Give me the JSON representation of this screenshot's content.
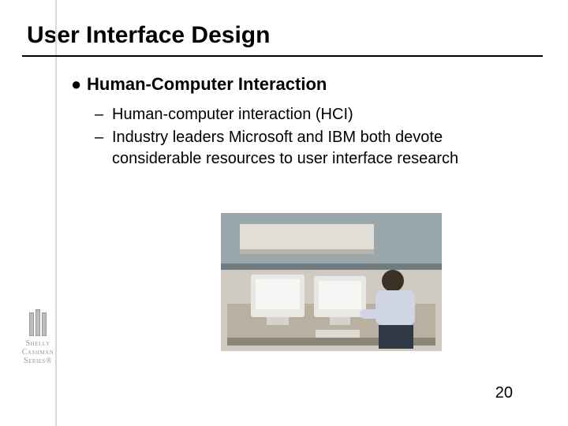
{
  "title": "User Interface Design",
  "bullet": {
    "mark": "●",
    "label": "Human-Computer Interaction",
    "subs": [
      "Human-computer interaction (HCI)",
      "Industry leaders Microsoft and IBM both devote considerable resources to user interface research"
    ]
  },
  "brand": {
    "line1": "Shelly",
    "line2": "Cashman",
    "line3": "Series",
    "mark": "®"
  },
  "figure_alt": "Photograph of a man seated at an office cubicle workstation with two CRT monitors",
  "page_number": "20"
}
